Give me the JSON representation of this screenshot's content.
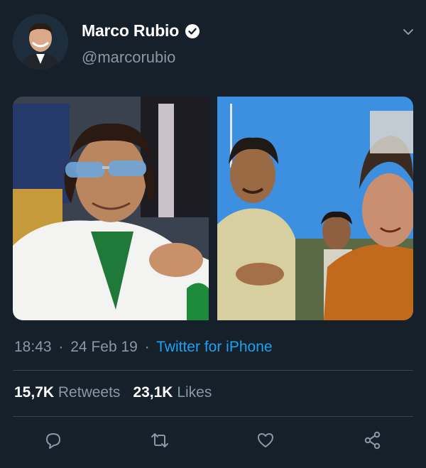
{
  "tweet": {
    "author": {
      "display_name": "Marco Rubio",
      "handle": "@marcorubio",
      "verified_icon": "verified-badge-icon"
    },
    "timestamp": "18:43",
    "date": "24 Feb 19",
    "separator": "·",
    "source": "Twitter for iPhone",
    "retweets_count": "15,7K",
    "retweets_label": "Retweets",
    "likes_count": "23,1K",
    "likes_label": "Likes"
  },
  "actions": [
    "reply-icon",
    "retweet-icon",
    "like-icon",
    "share-icon"
  ],
  "colors": {
    "background": "#15202b",
    "muted_text": "#8899a6",
    "link": "#1da1f2",
    "divider": "#38444d"
  }
}
